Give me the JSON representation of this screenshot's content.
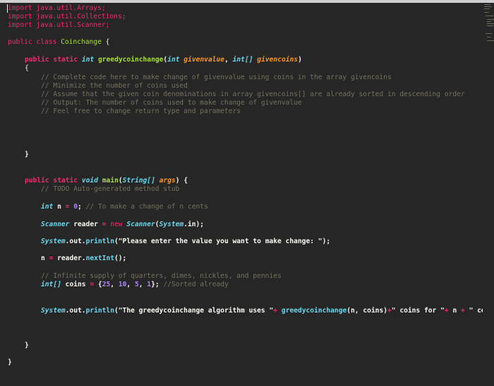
{
  "code": {
    "imports": [
      "import java.util.Arrays;",
      "import java.util.Collections;",
      "import java.util.Scanner;"
    ],
    "class_decl": {
      "mod": "public class",
      "name": "Coinchange",
      "brace": "{"
    },
    "method1_sig": {
      "mods": "public static",
      "ret": "int",
      "name": "greedycoinchange",
      "p1type": "int",
      "p1": "givenvalue",
      "p2type": "int[]",
      "p2": "givencoins"
    },
    "open_brace": "{",
    "comments": [
      "// Complete code here to make change of givenvalue using coins in the array givencoins",
      "// Minimize the number of coins used",
      "// Assume that the given coin denominations in array givencoins[] are already sorted in descending order",
      "// Output: The number of coins used to make change of givenvalue",
      "// Feel free to change return type and parameters"
    ],
    "close_brace": "}",
    "main_sig": {
      "mods": "public static",
      "ret": "void",
      "name": "main",
      "ptype": "String[]",
      "p": "args",
      "brace": "{"
    },
    "todo": "// TODO Auto-generated method stub",
    "int_n": {
      "type": "int",
      "name": "n",
      "op": "=",
      "val": "0",
      "semi": ";",
      "comment": "// To make a change of n cents"
    },
    "scanner_line": {
      "type": "Scanner",
      "name": "reader",
      "op": "=",
      "kw_new": "new",
      "ctor": "Scanner",
      "arg_cls": "System",
      "arg_rest": ".in);"
    },
    "println1": {
      "cls": "System",
      "mid": ".out.",
      "fn": "println",
      "open": "(",
      "str": "\"Please enter the value you want to make change: \"",
      "close": ");"
    },
    "read_line": {
      "name": "n",
      "op": "=",
      "obj": "reader.",
      "fn": "nextInt",
      "rest": "();"
    },
    "supply_comment": "// Infinite supply of quarters, dimes, nickles, and pennies",
    "coins_line": {
      "type": "int[]",
      "name": "coins",
      "op": "=",
      "open": "{",
      "n1": "25",
      "n2": "10",
      "n3": "5",
      "n4": "1",
      "close": "};",
      "comment": "//Sorted already"
    },
    "println2": {
      "cls": "System",
      "mid": ".out.",
      "fn": "println",
      "open": "(",
      "s1": "\"The greedycoinchange algorithm uses \"",
      "plus1": "+",
      "call": "greedycoinchange",
      "args": "(n, coins)",
      "plus2": "+",
      "s2": "\" coins for \"",
      "plus3": "+",
      "n": "n",
      "plus4": "+",
      "s3": "\" cen"
    },
    "inner_close": "}",
    "outer_close": "}"
  }
}
